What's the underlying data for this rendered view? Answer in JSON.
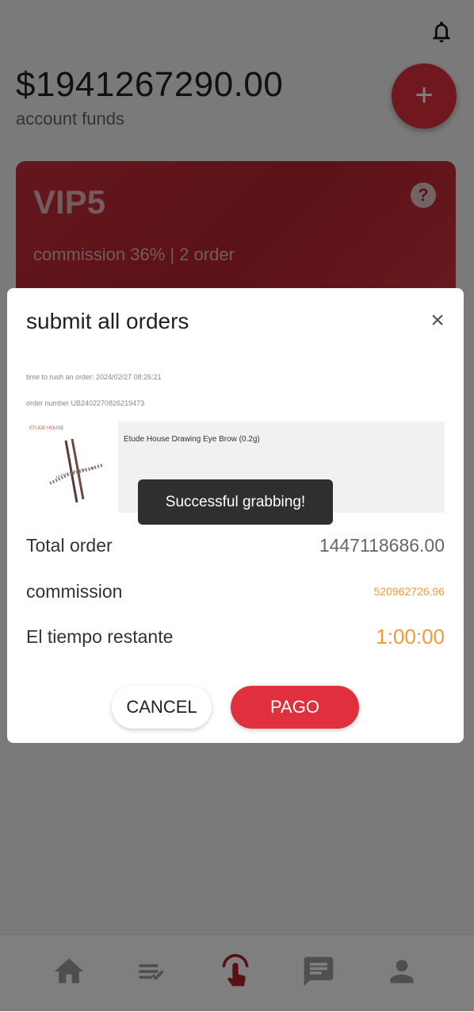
{
  "header": {
    "funds_amount": "$1941267290.00",
    "funds_label": "account funds",
    "add_button": "+"
  },
  "vip": {
    "level": "VIP5",
    "commission_text": "commission 36% | 2 order",
    "help_label": "?"
  },
  "modal": {
    "title": "submit all orders",
    "close_label": "×",
    "rush_time": "time to rush an order:  2024/02/27 08:26:21",
    "order_number": "order number UB2402270826219473",
    "brand_logo": "ETUDE HOUSE",
    "product_name": "Etude House Drawing Eye Brow (0.2g)",
    "rows": {
      "total_label": "Total order",
      "total_value": "1447118686.00",
      "commission_label": "commission",
      "commission_value": "520962726.96",
      "time_label": "El tiempo restante",
      "time_value": "1:00:00"
    },
    "cancel_label": "CANCEL",
    "pay_label": "PAGO"
  },
  "toast": {
    "message": "Successful grabbing!"
  },
  "nav": [
    "home-icon",
    "orders-icon",
    "grab-icon",
    "messages-icon",
    "profile-icon"
  ],
  "colors": {
    "accent": "#e0303d",
    "highlight": "#f29a36"
  }
}
